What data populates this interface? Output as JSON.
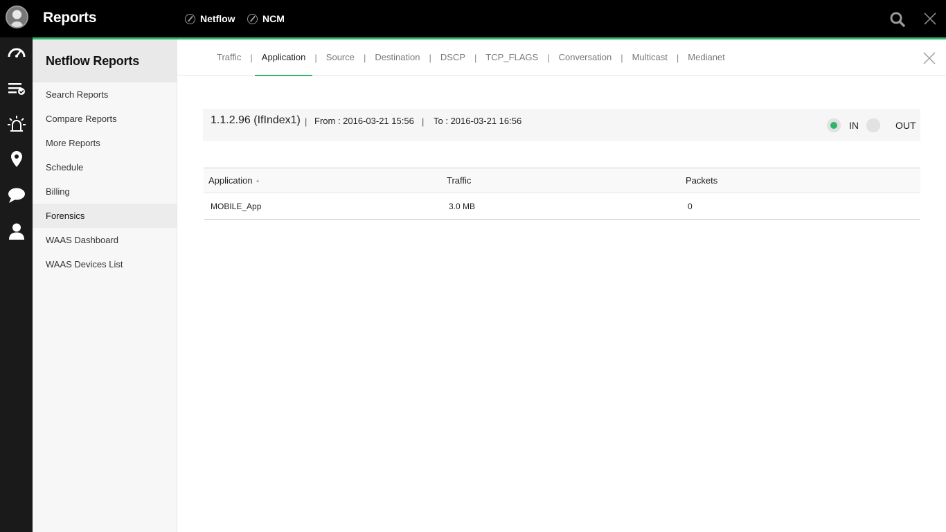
{
  "app": {
    "title": "Reports"
  },
  "modules": [
    {
      "label": "Netflow"
    },
    {
      "label": "NCM"
    }
  ],
  "sidebar": {
    "title": "Netflow Reports",
    "items": [
      {
        "label": "Search Reports"
      },
      {
        "label": "Compare Reports"
      },
      {
        "label": "More Reports"
      },
      {
        "label": "Schedule"
      },
      {
        "label": "Billing"
      },
      {
        "label": "Forensics",
        "active": true
      },
      {
        "label": "WAAS Dashboard"
      },
      {
        "label": "WAAS Devices List"
      }
    ]
  },
  "tabs": [
    {
      "label": "Traffic"
    },
    {
      "label": "Application",
      "active": true
    },
    {
      "label": "Source"
    },
    {
      "label": "Destination"
    },
    {
      "label": "DSCP"
    },
    {
      "label": "TCP_FLAGS"
    },
    {
      "label": "Conversation"
    },
    {
      "label": "Multicast"
    },
    {
      "label": "Medianet"
    }
  ],
  "tab_separator": "|",
  "info": {
    "interface": "1.1.2.96 (IfIndex1)",
    "separator": "|",
    "from": "From : 2016-03-21 15:56",
    "to": "To : 2016-03-21 16:56",
    "direction": {
      "in_label": "IN",
      "out_label": "OUT",
      "selected": "IN"
    }
  },
  "table": {
    "headers": {
      "application": "Application",
      "traffic": "Traffic",
      "packets": "Packets"
    },
    "sort_indicator": "▲",
    "rows": [
      {
        "application": "MOBILE_App",
        "traffic": "3.0 MB",
        "packets": "0"
      }
    ]
  },
  "icons": {
    "avatar": "user-avatar",
    "module": "compass-icon",
    "search": "search-icon",
    "close": "close-icon",
    "rail": [
      "dashboard-gauge-icon",
      "inventory-check-icon",
      "alarm-icon",
      "map-pin-icon",
      "chat-icon",
      "user-icon"
    ]
  },
  "colors": {
    "accent": "#2fb56a",
    "topbar": "#000000",
    "rail": "#1a1a1a"
  }
}
